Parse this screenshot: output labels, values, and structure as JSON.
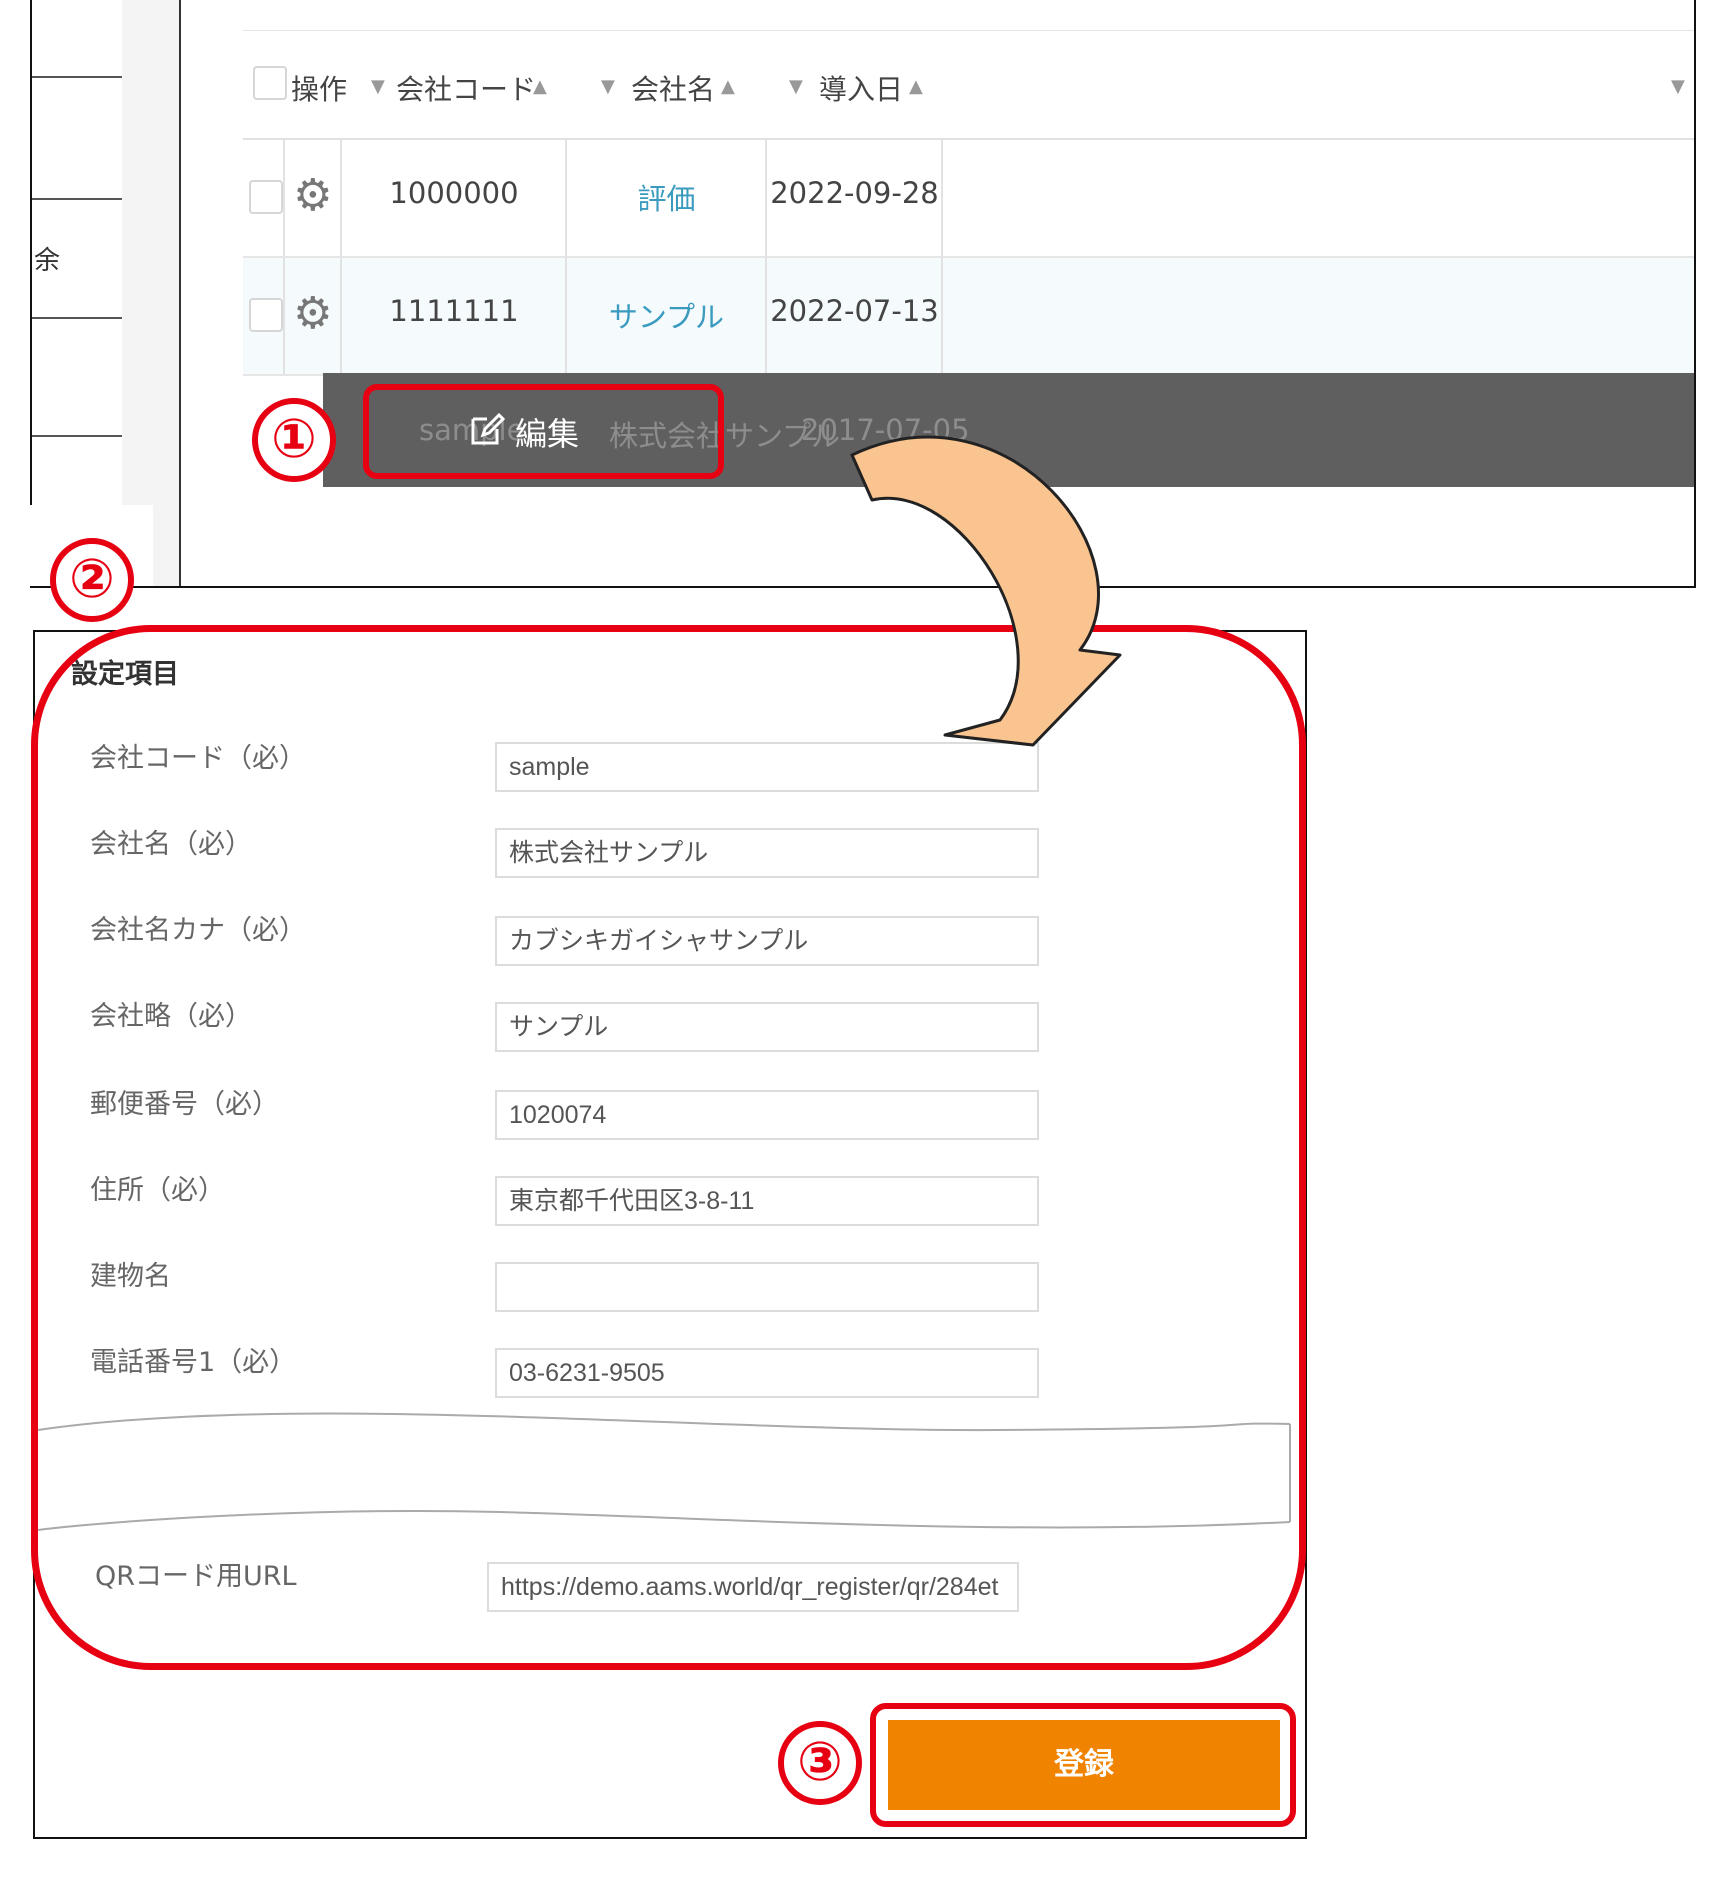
{
  "list": {
    "side_glyph": "余",
    "columns": {
      "operation": "操作",
      "company_code": "会社コード",
      "company_name": "会社名",
      "intro_date": "導入日"
    },
    "rows": [
      {
        "code": "1000000",
        "name": "評価",
        "date": "2022-09-28"
      },
      {
        "code": "1111111",
        "name": "サンプル",
        "date": "2022-07-13"
      },
      {
        "code": "sample",
        "name": "株式会社サンプル",
        "date": "2017-07-05"
      }
    ],
    "context_menu": {
      "edit_label": "編集",
      "edit_icon": "edit-icon"
    }
  },
  "steps": {
    "one": "①",
    "two": "②",
    "three": "③"
  },
  "form": {
    "section_title": "設定項目",
    "fields": [
      {
        "label": "会社コード（必）",
        "value": "sample"
      },
      {
        "label": "会社名（必）",
        "value": "株式会社サンプル"
      },
      {
        "label": "会社名カナ（必）",
        "value": "カブシキガイシャサンプル"
      },
      {
        "label": "会社略（必）",
        "value": "サンプル"
      },
      {
        "label": "郵便番号（必）",
        "value": "1020074"
      },
      {
        "label": "住所（必）",
        "value": "東京都千代田区3-8-11"
      },
      {
        "label": "建物名",
        "value": ""
      },
      {
        "label": "電話番号1（必）",
        "value": "03-6231-9505"
      }
    ],
    "qr": {
      "label": "QRコード用URL",
      "value": "https://demo.aams.world/qr_register/qr/284et"
    },
    "register_label": "登録"
  },
  "colors": {
    "highlight": "#e60012",
    "register_button": "#f08300",
    "link": "#3b9bbf",
    "context_bar": "#5f5f5f",
    "arrow_fill": "#f9c48f"
  }
}
